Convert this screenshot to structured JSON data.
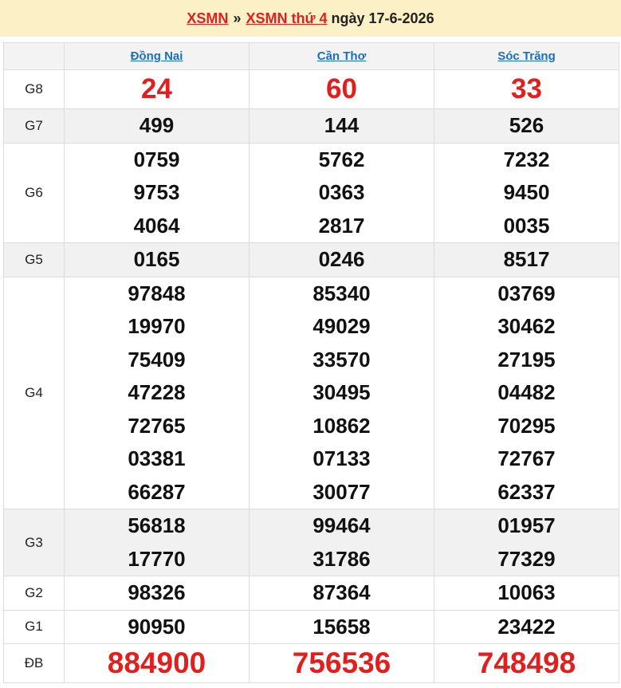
{
  "header": {
    "link1": "XSMN",
    "sep": "»",
    "link2": "XSMN thứ 4",
    "date": "ngày 17-6-2026"
  },
  "provinces": [
    "Đồng Nai",
    "Cần Thơ",
    "Sóc Trăng"
  ],
  "prizes": [
    {
      "label": "G8",
      "values": [
        [
          "24"
        ],
        [
          "60"
        ],
        [
          "33"
        ]
      ]
    },
    {
      "label": "G7",
      "values": [
        [
          "499"
        ],
        [
          "144"
        ],
        [
          "526"
        ]
      ]
    },
    {
      "label": "G6",
      "values": [
        [
          "0759",
          "9753",
          "4064"
        ],
        [
          "5762",
          "0363",
          "2817"
        ],
        [
          "7232",
          "9450",
          "0035"
        ]
      ]
    },
    {
      "label": "G5",
      "values": [
        [
          "0165"
        ],
        [
          "0246"
        ],
        [
          "8517"
        ]
      ]
    },
    {
      "label": "G4",
      "values": [
        [
          "97848",
          "19970",
          "75409",
          "47228",
          "72765",
          "03381",
          "66287"
        ],
        [
          "85340",
          "49029",
          "33570",
          "30495",
          "10862",
          "07133",
          "30077"
        ],
        [
          "03769",
          "30462",
          "27195",
          "04482",
          "70295",
          "72767",
          "62337"
        ]
      ]
    },
    {
      "label": "G3",
      "values": [
        [
          "56818",
          "17770"
        ],
        [
          "99464",
          "31786"
        ],
        [
          "01957",
          "77329"
        ]
      ]
    },
    {
      "label": "G2",
      "values": [
        [
          "98326"
        ],
        [
          "87364"
        ],
        [
          "10063"
        ]
      ]
    },
    {
      "label": "G1",
      "values": [
        [
          "90950"
        ],
        [
          "15658"
        ],
        [
          "23422"
        ]
      ]
    },
    {
      "label": "ĐB",
      "values": [
        [
          "884900"
        ],
        [
          "756536"
        ],
        [
          "748498"
        ]
      ]
    }
  ]
}
